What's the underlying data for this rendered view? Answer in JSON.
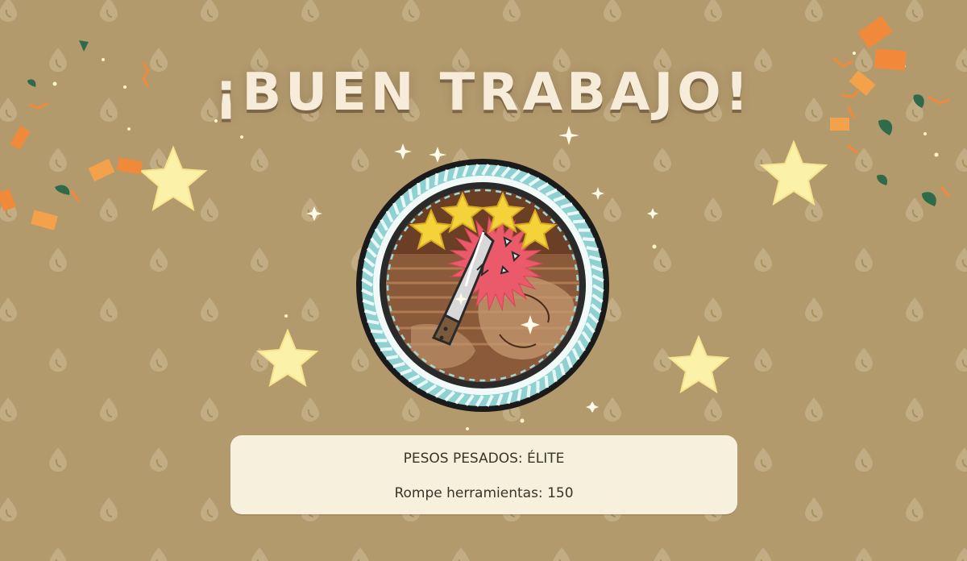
{
  "screen": {
    "title": "¡BUEN TRABAJO!",
    "achievement": {
      "name_label": "PESOS PESADOS: ÉLITE",
      "detail_label": "Rompe herramientas: 150",
      "stars_earned": 4,
      "stars_total": 4,
      "badge_icon": "broken-knife-icon"
    }
  },
  "colors": {
    "background": "#b39a6d",
    "title": "#f6ecd9",
    "panel": "#f6f0dc",
    "panel_text": "#3b3328",
    "star": "#f4d23a",
    "badge_ring": "#8fd0d0",
    "burst": "#ea5a6a",
    "confetti_orange": "#f08a3a",
    "confetti_green": "#2f6b4a"
  }
}
